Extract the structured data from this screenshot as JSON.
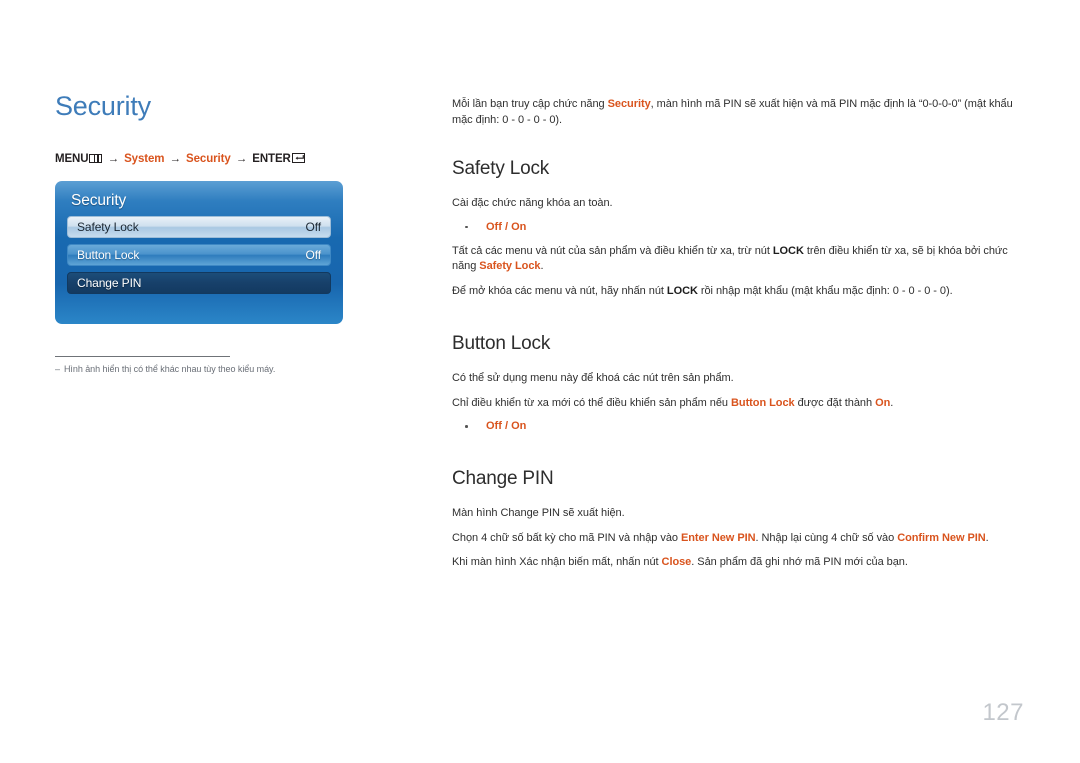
{
  "page": {
    "title": "Security",
    "number": "127"
  },
  "breadcrumb": {
    "menu_label": "MENU",
    "menu_icon": "menu-grid-icon",
    "arrow": "→",
    "step1": "System",
    "step2": "Security",
    "enter_label": "ENTER",
    "enter_icon": "enter-return-icon"
  },
  "osd": {
    "title": "Security",
    "rows": [
      {
        "label": "Safety Lock",
        "value": "Off",
        "style": "light"
      },
      {
        "label": "Button Lock",
        "value": "Off",
        "style": "medium"
      },
      {
        "label": "Change PIN",
        "value": "",
        "style": "dark"
      }
    ]
  },
  "footnote": {
    "dash": "‒",
    "text": "Hình ảnh hiển thị có thể khác nhau tùy theo kiểu máy."
  },
  "intro": {
    "p1_a": "Mỗi lần bạn truy cập chức năng ",
    "p1_accent": "Security",
    "p1_b": ", màn hình mã PIN sẽ xuất hiện và mã PIN mặc định là “0-0-0-0” (mật khẩu mặc định: 0 - 0 - 0 - 0)."
  },
  "sections": [
    {
      "heading": "Safety Lock",
      "lead": "Cài đặc chức năng khóa an toàn.",
      "bullets": [
        {
          "off": "Off",
          "sep": " / ",
          "on": "On"
        }
      ],
      "p2_a": "Tất cả các menu và nút của sản phẩm và điều khiển từ xa, trừ nút ",
      "p2_strong": "LOCK",
      "p2_b": " trên điều khiển từ xa, sẽ bị khóa bởi chức năng ",
      "p2_accent": "Safety Lock",
      "p2_c": ".",
      "p3_a": "Để mở khóa các menu và nút, hãy nhấn nút ",
      "p3_strong": "LOCK",
      "p3_b": " rồi nhập mật khẩu (mật khẩu mặc định: 0 - 0 - 0 - 0)."
    },
    {
      "heading": "Button Lock",
      "lead": "Có thể sử dụng menu này để khoá các nút trên sản phẩm.",
      "p2_a": "Chỉ điều khiển từ xa mới có thể điều khiển sản phẩm nếu ",
      "p2_accent": "Button Lock",
      "p2_b": " được đặt thành ",
      "p2_accent2": "On",
      "p2_c": ".",
      "bullets": [
        {
          "off": "Off",
          "sep": " / ",
          "on": "On"
        }
      ]
    },
    {
      "heading": "Change PIN",
      "lead": "Màn hình Change PIN sẽ xuất hiện.",
      "p2_a": "Chọn 4 chữ số bất kỳ cho mã PIN và nhập vào ",
      "p2_accent": "Enter New PIN",
      "p2_b": ". Nhập lại cùng 4 chữ số vào ",
      "p2_accent2": "Confirm New PIN",
      "p2_c": ".",
      "p3_a": "Khi màn hình Xác nhận biến mất, nhấn nút ",
      "p3_accent": "Close",
      "p3_b": ". Sản phẩm đã ghi nhớ mã PIN mới của bạn."
    }
  ],
  "colors": {
    "title_blue": "#3e7cb9",
    "accent_orange": "#d9541e",
    "osd_blue": "#1869b0",
    "page_number_gray": "#c3c7cc"
  }
}
